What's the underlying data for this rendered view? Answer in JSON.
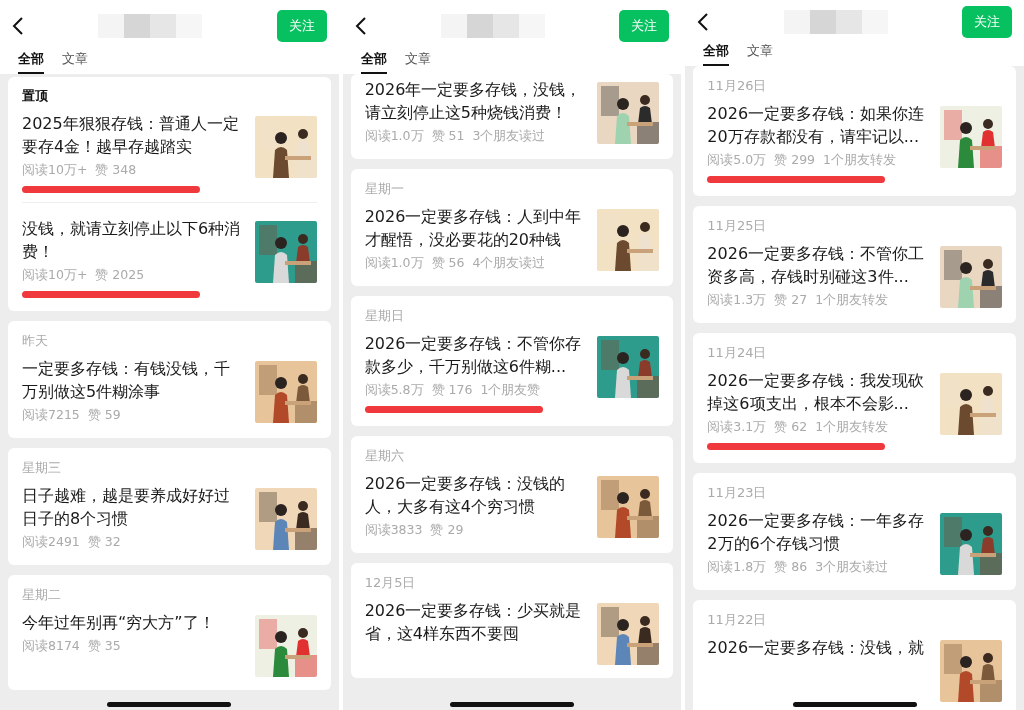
{
  "panels": [
    {
      "follow_button": "关注",
      "tabs": [
        {
          "label": "全部",
          "selected": true
        },
        {
          "label": "文章",
          "selected": false
        }
      ],
      "cards": [
        {
          "kind": "pinned",
          "label": "置顶",
          "articles": [
            {
              "title": "2025年狠狠存钱：普通人一定要存4金！越早存越踏实",
              "meta": [
                "阅读10万+",
                "赞 348"
              ],
              "underlined": true
            },
            {
              "title": "没钱，就请立刻停止以下6种消费！",
              "meta": [
                "阅读10万+",
                "赞 2025"
              ],
              "underlined": true
            }
          ]
        },
        {
          "kind": "dated",
          "label": "昨天",
          "articles": [
            {
              "title": "一定要多存钱：有钱没钱，千万别做这5件糊涂事",
              "meta": [
                "阅读7215",
                "赞 59"
              ],
              "underlined": false
            }
          ]
        },
        {
          "kind": "dated",
          "label": "星期三",
          "articles": [
            {
              "title": "日子越难，越是要养成好好过日子的8个习惯",
              "meta": [
                "阅读2491",
                "赞 32"
              ],
              "underlined": false
            }
          ]
        },
        {
          "kind": "dated",
          "label": "星期二",
          "articles": [
            {
              "title": "今年过年别再“穷大方”了！",
              "meta": [
                "阅读8174",
                "赞 35"
              ],
              "underlined": false
            }
          ]
        }
      ]
    },
    {
      "follow_button": "关注",
      "tabs": [
        {
          "label": "全部",
          "selected": true
        },
        {
          "label": "文章",
          "selected": false
        }
      ],
      "cards": [
        {
          "kind": "continued",
          "articles": [
            {
              "title": "2026年一定要多存钱，没钱，请立刻停止这5种烧钱消费！",
              "meta": [
                "阅读1.0万",
                "赞 51",
                "3个朋友读过"
              ],
              "underlined": false
            }
          ]
        },
        {
          "kind": "dated",
          "label": "星期一",
          "articles": [
            {
              "title": "2026一定要多存钱：人到中年才醒悟，没必要花的20种钱",
              "meta": [
                "阅读1.0万",
                "赞 56",
                "4个朋友读过"
              ],
              "underlined": false
            }
          ]
        },
        {
          "kind": "dated",
          "label": "星期日",
          "articles": [
            {
              "title": "2026一定要多存钱：不管你存款多少，千万别做这6件糊...",
              "meta": [
                "阅读5.8万",
                "赞 176",
                "1个朋友赞"
              ],
              "underlined": true
            }
          ]
        },
        {
          "kind": "dated",
          "label": "星期六",
          "articles": [
            {
              "title": "2026一定要多存钱：没钱的人，大多有这4个穷习惯",
              "meta": [
                "阅读3833",
                "赞 29"
              ],
              "underlined": false
            }
          ]
        },
        {
          "kind": "dated",
          "label": "12月5日",
          "articles": [
            {
              "title": "2026一定要多存钱：少买就是省，这4样东西不要囤",
              "underlined": false
            }
          ]
        }
      ]
    },
    {
      "follow_button": "关注",
      "tabs": [
        {
          "label": "全部",
          "selected": true
        },
        {
          "label": "文章",
          "selected": false
        }
      ],
      "cards": [
        {
          "kind": "dated",
          "label": "11月26日",
          "articles": [
            {
              "title": "2026一定要多存钱：如果你连20万存款都没有，请牢记以...",
              "meta": [
                "阅读5.0万",
                "赞 299",
                "1个朋友转发"
              ],
              "underlined": true
            }
          ]
        },
        {
          "kind": "dated",
          "label": "11月25日",
          "articles": [
            {
              "title": "2026一定要多存钱：不管你工资多高，存钱时别碰这3件...",
              "meta": [
                "阅读1.3万",
                "赞 27",
                "1个朋友转发"
              ],
              "underlined": false
            }
          ]
        },
        {
          "kind": "dated",
          "label": "11月24日",
          "articles": [
            {
              "title": "2026一定要多存钱：我发现砍掉这6项支出，根本不会影...",
              "meta": [
                "阅读3.1万",
                "赞 62",
                "1个朋友转发"
              ],
              "underlined": true
            }
          ]
        },
        {
          "kind": "dated",
          "label": "11月23日",
          "articles": [
            {
              "title": "2026一定要多存钱：一年多存2万的6个存钱习惯",
              "meta": [
                "阅读1.8万",
                "赞 86",
                "3个朋友读过"
              ],
              "underlined": false
            }
          ]
        },
        {
          "kind": "dated",
          "label": "11月22日",
          "articles": [
            {
              "title": "2026一定要多存钱：没钱，就",
              "underlined": false
            }
          ]
        }
      ]
    }
  ]
}
